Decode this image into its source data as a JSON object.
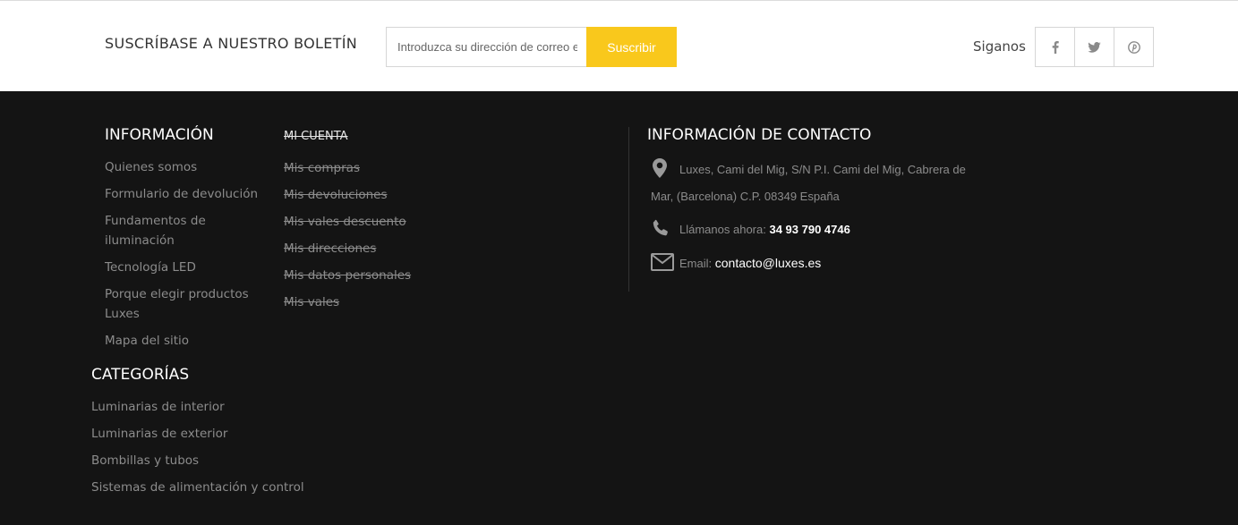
{
  "newsletter": {
    "title": "SUSCRÍBASE A NUESTRO BOLETÍN",
    "placeholder": "Introduzca su dirección de correo electrónico",
    "button": "Suscribir"
  },
  "social": {
    "label": "Siganos",
    "icons": [
      "facebook-icon",
      "twitter-icon",
      "pinterest-icon"
    ]
  },
  "info": {
    "title": "INFORMACIÓN",
    "links": [
      "Quienes somos",
      "Formulario de devolución",
      "Fundamentos de iluminación",
      "Tecnología LED",
      "Porque elegir productos Luxes",
      "Mapa del sitio"
    ]
  },
  "account": {
    "title": "MI CUENTA",
    "links": [
      "Mis compras",
      "Mis devoluciones",
      "Mis vales descuento",
      "Mis direcciones",
      "Mis datos personales",
      "Mis vales"
    ]
  },
  "categories": {
    "title": "CATEGORÍAS",
    "links": [
      "Luminarias de interior",
      "Luminarias de exterior",
      "Bombillas y tubos",
      "Sistemas de alimentación y control"
    ]
  },
  "contact": {
    "title": "INFORMACIÓN DE CONTACTO",
    "address": "Luxes, Cami del Mig, S/N P.I. Cami del Mig, Cabrera de Mar, (Barcelona) C.P. 08349 España",
    "phone_label": "Llámanos ahora:",
    "phone": "34 93 790 4746",
    "email_label": "Email:",
    "email": "contacto@luxes.es"
  },
  "colors": {
    "accent": "#f9c81c",
    "footer_bg": "#141414",
    "link": "#8c8c8c"
  }
}
